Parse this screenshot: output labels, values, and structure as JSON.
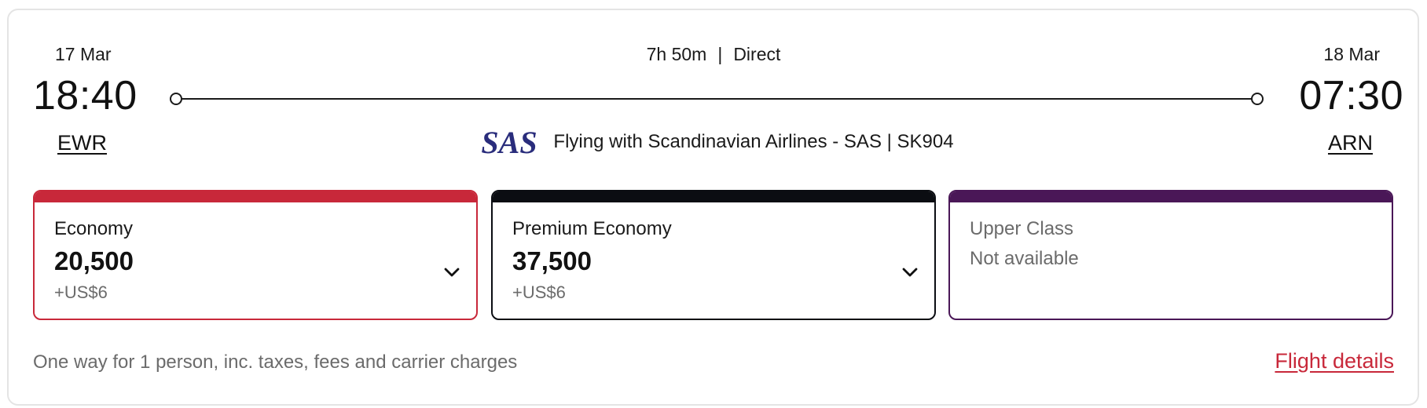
{
  "flight": {
    "departure": {
      "date": "17 Mar",
      "time": "18:40",
      "airport": "EWR"
    },
    "arrival": {
      "date": "18 Mar",
      "time": "07:30",
      "airport": "ARN"
    },
    "duration": "7h 50m",
    "separator": "|",
    "stops": "Direct",
    "carrier_text": "Flying with Scandinavian Airlines - SAS | SK904",
    "carrier_logo": "SAS"
  },
  "fares": [
    {
      "class": "Economy",
      "points": "20,500",
      "fee": "+US$6",
      "available": true,
      "accent": "#c8283a"
    },
    {
      "class": "Premium Economy",
      "points": "37,500",
      "fee": "+US$6",
      "available": true,
      "accent": "#0b0d12"
    },
    {
      "class": "Upper Class",
      "status": "Not available",
      "available": false,
      "accent": "#4a1757"
    }
  ],
  "footer": {
    "note": "One way for 1 person, inc. taxes, fees and carrier charges",
    "details_link": "Flight details"
  },
  "icons": {
    "route_endpoints": "circle-outline",
    "fare_expand": "chevron-down-icon",
    "airline_logo": "sas-logo"
  },
  "colors": {
    "brand_red": "#c8283a",
    "sas_blue": "#2a2d7c",
    "upper_purple": "#4a1757"
  }
}
